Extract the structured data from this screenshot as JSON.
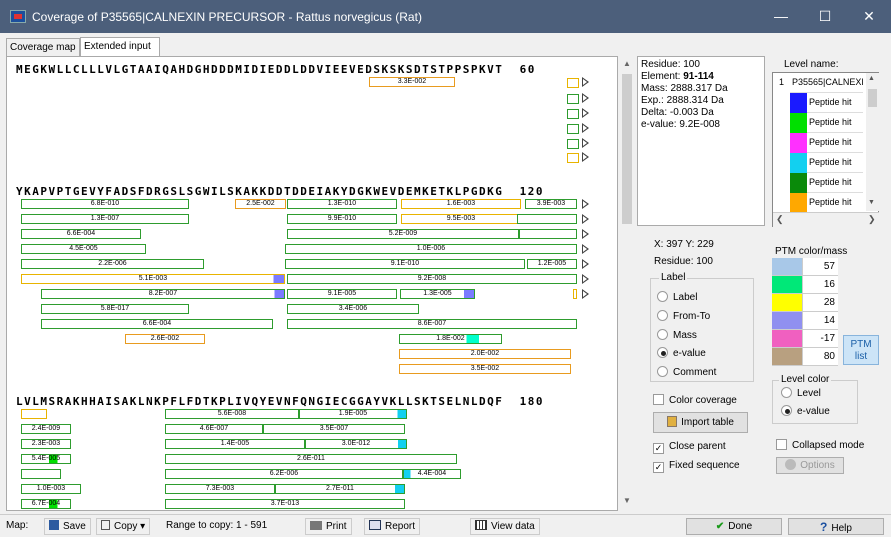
{
  "window": {
    "title": "Coverage of P35565|CALNEXIN PRECURSOR - Rattus norvegicus (Rat)"
  },
  "tabs": [
    "Coverage map",
    "Extended input"
  ],
  "sequence": {
    "lines": [
      {
        "text": "MEGKWLLCLLLVLGTAAIQAHDGHDDDMIDIEDDLDDVIEEVEDSKSKSDTSTPPSPKVT",
        "end": "60"
      },
      {
        "text": "YKAPVPTGEVYFADSFDRGSLSGWILSKAKKDDTDDEIAKYDGKWEVDEMKETKLPGDKG",
        "end": "120"
      },
      {
        "text": "LVLMSRAKHHAISAKLNKPFLFDTKPLIVQYEVNFQNGIECGGAYVKLLSKTSELNLDQF",
        "end": "180"
      }
    ],
    "block1_bars": [
      "3.3E-002"
    ],
    "block2_bars": [
      "6.8E-010",
      "2.5E-002",
      "1.3E-010",
      "1.6E-003",
      "3.9E-003",
      "1.3E-007",
      "9.9E-010",
      "9.5E-003",
      "6.6E-004",
      "5.2E-009",
      "4.5E-005",
      "1.0E-006",
      "2.2E-006",
      "9.1E-010",
      "1.2E-005",
      "5.1E-003",
      "9.2E-008",
      "8.2E-007",
      "9.1E-005",
      "1.3E-005",
      "5.8E-017",
      "3.4E-006",
      "6.6E-004",
      "8.6E-007",
      "2.6E-002",
      "1.8E-002",
      "2.0E-002",
      "3.5E-002"
    ],
    "block3_bars": [
      "5.6E-008",
      "1.9E-005",
      "2.4E-009",
      "4.6E-007",
      "3.5E-007",
      "2.3E-003",
      "1.4E-005",
      "3.0E-012",
      "5.4E-005",
      "2.6E-011",
      "6.2E-006",
      "4.4E-004",
      "1.0E-003",
      "7.3E-003",
      "2.7E-011",
      "6.7E-004",
      "3.7E-013"
    ]
  },
  "info": {
    "residue": "Residue: 100",
    "element_label": "Element:",
    "element_value": "91-114",
    "mass": "Mass:  2888.317 Da",
    "exp": "Exp.:  2888.314 Da",
    "delta": "Delta:  -0.003 Da",
    "evalue": "e-value: 9.2E-008"
  },
  "levels": {
    "header": "Level name:",
    "rows": [
      {
        "num": "1",
        "label": "P35565|CALNEXIN",
        "color": "#ffffff"
      },
      {
        "num": "",
        "label": "Peptide hit",
        "color": "#1a1aff"
      },
      {
        "num": "",
        "label": "Peptide hit",
        "color": "#00e000"
      },
      {
        "num": "",
        "label": "Peptide hit",
        "color": "#ff30ff"
      },
      {
        "num": "",
        "label": "Peptide hit",
        "color": "#12d0f0"
      },
      {
        "num": "",
        "label": "Peptide hit",
        "color": "#0a8a0a"
      },
      {
        "num": "",
        "label": "Peptide hit",
        "color": "#ffa800"
      }
    ]
  },
  "cursor": {
    "coords": "X: 397  Y: 229",
    "residue": "Residue: 100"
  },
  "label_group": {
    "title": "Label",
    "options": [
      "Label",
      "From-To",
      "Mass",
      "e-value",
      "Comment"
    ],
    "selected": "e-value"
  },
  "color_coverage": "Color coverage",
  "import_table": "Import table",
  "close_parent": "Close parent",
  "fixed_sequence": "Fixed sequence",
  "ptm": {
    "header": "PTM color/mass",
    "rows": [
      {
        "color": "#a8c8e8",
        "value": "57"
      },
      {
        "color": "#00e878",
        "value": "16"
      },
      {
        "color": "#ffff00",
        "value": "28"
      },
      {
        "color": "#9090f0",
        "value": "14"
      },
      {
        "color": "#f060c0",
        "value": "-17"
      },
      {
        "color": "#b8a080",
        "value": "80"
      }
    ],
    "list_button": "PTM list"
  },
  "level_color": {
    "title": "Level color",
    "options": [
      "Level",
      "e-value"
    ],
    "selected": "e-value"
  },
  "collapsed_mode": "Collapsed mode",
  "options_button": "Options",
  "statusbar": {
    "map_label": "Map:",
    "save": "Save",
    "copy": "Copy",
    "range": "Range to copy: 1 - 591",
    "print": "Print",
    "report": "Report",
    "view_data": "View data",
    "done": "Done",
    "help": "Help"
  }
}
